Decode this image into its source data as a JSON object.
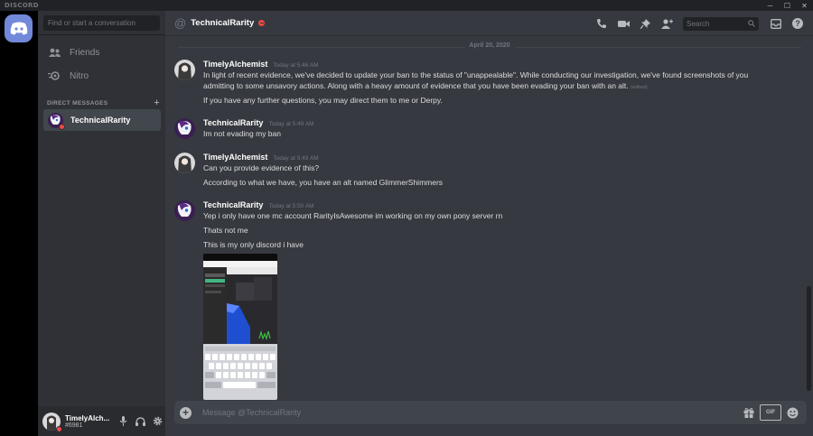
{
  "app": {
    "brand": "DISCORD",
    "minimize": "─",
    "maximize": "☐",
    "close": "✕"
  },
  "colors": {
    "blurple": "#7289da",
    "dnd": "#f04747",
    "bg_main": "#36393f",
    "bg_side": "#2f3136",
    "bg_rail": "#000000"
  },
  "sidebar": {
    "search_placeholder": "Find or start a conversation",
    "nav": [
      {
        "label": "Friends",
        "icon": "friends-icon"
      },
      {
        "label": "Nitro",
        "icon": "nitro-icon"
      }
    ],
    "dm_heading": "DIRECT MESSAGES",
    "dm_add": "+",
    "dms": [
      {
        "name": "TechnicalRarity",
        "status": "dnd"
      }
    ]
  },
  "user_panel": {
    "name": "TimelyAlch...",
    "tag": "#6981",
    "status": "dnd"
  },
  "header": {
    "at": "@",
    "channel": "TechnicalRarity",
    "search_placeholder": "Search",
    "help": "?"
  },
  "date_divider": "April 20, 2020",
  "messages": [
    {
      "author": "TimelyAlchemist",
      "time": "Today at 5:46 AM",
      "lines": [
        "In light of recent evidence, we've decided to update your ban to the status of \"unappealable\". While conducting our investigation, we've found screenshots of you",
        "admitting to some unsavory actions. Along with a heavy amount of evidence that you have been evading your ban with an alt."
      ],
      "edited": "(edited)",
      "extra": [
        "If you have any further questions, you may direct them to me or Derpy."
      ]
    },
    {
      "author": "TechnicalRarity",
      "time": "Today at 5:49 AM",
      "lines": [
        "Im not evading my ban"
      ]
    },
    {
      "author": "TimelyAlchemist",
      "time": "Today at 5:49 AM",
      "lines": [
        "Can you provide evidence of this?"
      ],
      "extra": [
        "According to what we have, you have an alt named GlimmerShimmers"
      ]
    },
    {
      "author": "TechnicalRarity",
      "time": "Today at 5:50 AM",
      "lines": [
        "Yep i only have one mc account RarityIsAwesome im working on my own pony server rn"
      ],
      "extra": [
        "Thats not me",
        "This is my only discord i have"
      ]
    }
  ],
  "composer": {
    "placeholder": "Message @TechnicalRarity",
    "gif": "GIF",
    "plus": "+"
  }
}
